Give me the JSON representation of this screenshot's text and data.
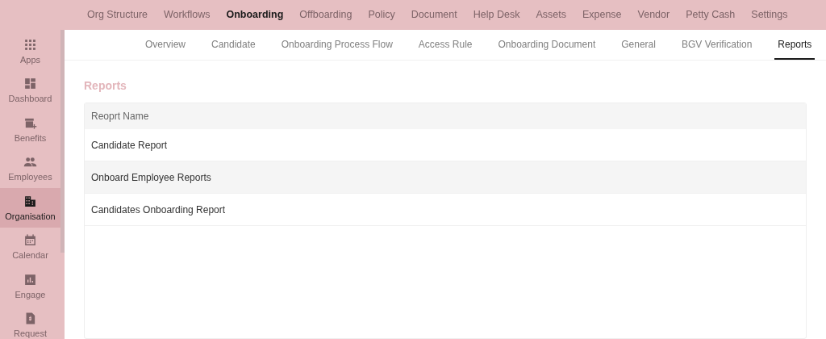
{
  "top_nav": [
    {
      "label": "Org Structure",
      "selected": false
    },
    {
      "label": "Workflows",
      "selected": false
    },
    {
      "label": "Onboarding",
      "selected": true
    },
    {
      "label": "Offboarding",
      "selected": false
    },
    {
      "label": "Policy",
      "selected": false
    },
    {
      "label": "Document",
      "selected": false
    },
    {
      "label": "Help Desk",
      "selected": false
    },
    {
      "label": "Assets",
      "selected": false
    },
    {
      "label": "Expense",
      "selected": false
    },
    {
      "label": "Vendor",
      "selected": false
    },
    {
      "label": "Petty Cash",
      "selected": false
    },
    {
      "label": "Settings",
      "selected": false
    }
  ],
  "sidebar": {
    "items": [
      {
        "label": "Apps",
        "selected": false
      },
      {
        "label": "Dashboard",
        "selected": false
      },
      {
        "label": "Benefits",
        "selected": false
      },
      {
        "label": "Employees",
        "selected": false
      },
      {
        "label": "Organisation",
        "selected": true
      },
      {
        "label": "Calendar",
        "selected": false
      },
      {
        "label": "Engage",
        "selected": false
      },
      {
        "label": "Request",
        "selected": false
      }
    ]
  },
  "tabs": [
    {
      "label": "Overview",
      "selected": false
    },
    {
      "label": "Candidate",
      "selected": false
    },
    {
      "label": "Onboarding Process Flow",
      "selected": false
    },
    {
      "label": "Access Rule",
      "selected": false
    },
    {
      "label": "Onboarding Document",
      "selected": false
    },
    {
      "label": "General",
      "selected": false
    },
    {
      "label": "BGV Verification",
      "selected": false
    },
    {
      "label": "Reports",
      "selected": true
    }
  ],
  "section_title": "Reports",
  "table": {
    "columns": [
      "Reoprt Name"
    ],
    "rows": [
      [
        "Candidate Report"
      ],
      [
        "Onboard Employee Reports"
      ],
      [
        "Candidates Onboarding Report"
      ]
    ]
  }
}
